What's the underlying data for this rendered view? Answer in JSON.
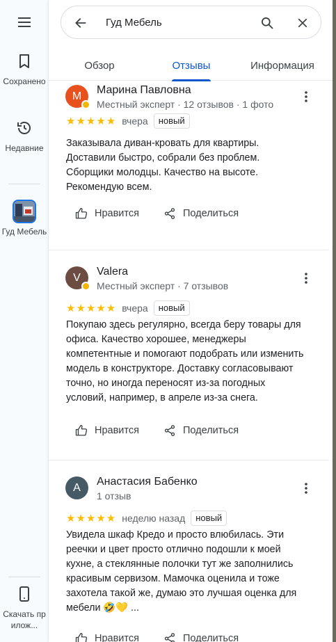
{
  "rail": {
    "saved_label": "Сохранено",
    "recent_label": "Недавние",
    "place_label": "Гуд Мебель",
    "download_label": "Скачать прилож..."
  },
  "search": {
    "query": "Гуд Мебель"
  },
  "tabs": [
    {
      "label": "Обзор",
      "active": false
    },
    {
      "label": "Отзывы",
      "active": true
    },
    {
      "label": "Информация",
      "active": false
    }
  ],
  "actions": {
    "like": "Нравится",
    "share": "Поделиться"
  },
  "reviews": [
    {
      "author": "Марина Павловна",
      "initial": "М",
      "avatar_color": "#e8501e",
      "meta": "Местный эксперт · 12 отзывов · 1 фото",
      "stars": "★★★★★",
      "rating": 5,
      "when": "вчера",
      "badge": "новый",
      "text": "Заказывала диван-кровать для квартиры. Доставили быстро, собрали без проблем. Сборщики молодцы. Качество на высоте. Рекомендую всем."
    },
    {
      "author": "Valera",
      "initial": "V",
      "avatar_color": "#6d4c41",
      "meta": "Местный эксперт · 7 отзывов",
      "stars": "★★★★★",
      "rating": 5,
      "when": "вчера",
      "badge": "новый",
      "text": "Покупаю здесь регулярно, всегда беру товары для офиса. Качество хорошее, менеджеры компетентные и помогают подобрать или изменить модель в конструкторе. Доставку согласовывают точно, но иногда переносят из-за погодных условий, например, в апреле из-за снега."
    },
    {
      "author": "Анастасия Бабенко",
      "initial": "А",
      "avatar_color": "#455a64",
      "meta": "1 отзыв",
      "stars": "★★★★★",
      "rating": 5,
      "when": "неделю назад",
      "badge": "новый",
      "text": "Увидела шкаф Кредо и просто влюбилась. Эти реечки и цвет просто отлично подошли к моей кухне, а стеклянные полочки тут же заполнились красивым сервизом. Мамочка оценила и тоже захотела такой же, думаю это лучшая оценка для мебели 🤣💛 ..."
    }
  ],
  "colors": {
    "accent": "#0b57d0",
    "star": "#fbbc04"
  }
}
